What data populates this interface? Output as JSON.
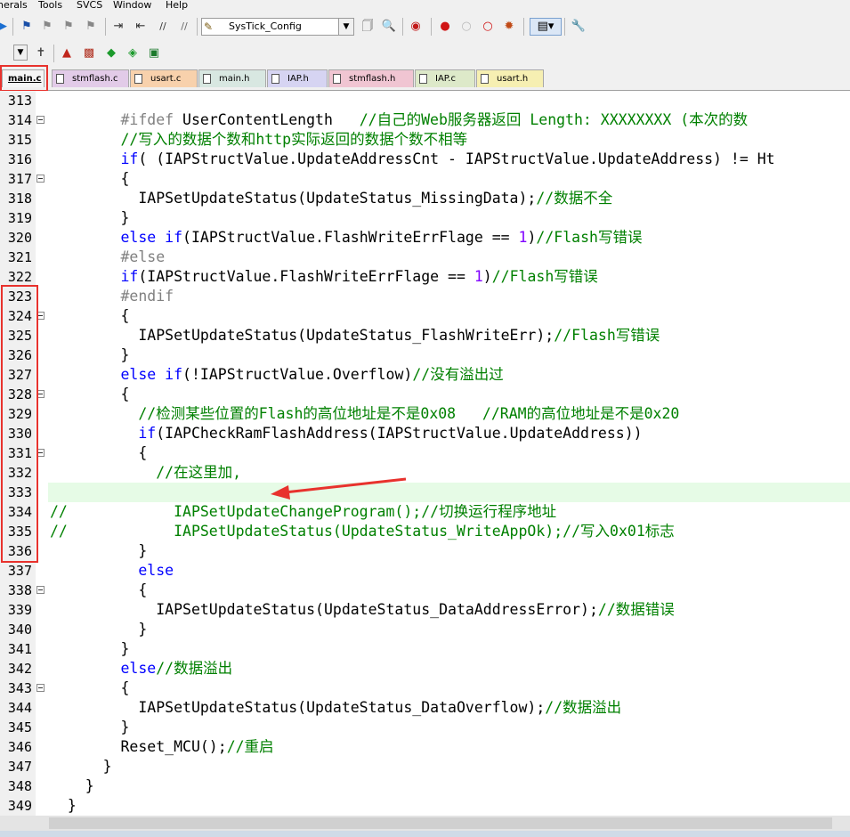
{
  "menu": [
    "herals",
    "Tools",
    "SVCS",
    "Window",
    "Help"
  ],
  "toolbar": {
    "target_combo": "SysTick_Config",
    "icons": [
      "run-icon",
      "bookmark-icon",
      "prev-bookmark-icon",
      "next-bookmark-icon",
      "clear-bookmarks-icon",
      "indent-icon",
      "unindent-icon",
      "comment-icon",
      "uncomment-icon",
      "find-in-files-icon",
      "find-icon",
      "debug-icon",
      "breakpoint-icon",
      "disable-breakpoint-icon",
      "kill-breakpoints-icon",
      "window-layout-icon",
      "configure-icon"
    ]
  },
  "tabs": [
    {
      "label": "main.c",
      "active": true,
      "color": "#f5f5f5"
    },
    {
      "label": "stmflash.c",
      "active": false,
      "color": "#e2cbe8"
    },
    {
      "label": "usart.c",
      "active": false,
      "color": "#f8d1ac"
    },
    {
      "label": "main.h",
      "active": false,
      "color": "#d8e7e1"
    },
    {
      "label": "IAP.h",
      "active": false,
      "color": "#d6d4f2"
    },
    {
      "label": "stmflash.h",
      "active": false,
      "color": "#f0c5d2"
    },
    {
      "label": "IAP.c",
      "active": false,
      "color": "#dde9c9"
    },
    {
      "label": "usart.h",
      "active": false,
      "color": "#f6efb2"
    }
  ],
  "lines": [
    {
      "num": "313",
      "fold": false,
      "code": ""
    },
    {
      "num": "314",
      "fold": true,
      "code": "        #ifdef UserContentLength   //自己的Web服务器返回 Length: XXXXXXXX (本次的数"
    },
    {
      "num": "315",
      "fold": false,
      "code": "        //写入的数据个数和http实际返回的数据个数不相等"
    },
    {
      "num": "316",
      "fold": false,
      "code": "        if( (IAPStructValue.UpdateAddressCnt - IAPStructValue.UpdateAddress) != Ht"
    },
    {
      "num": "317",
      "fold": true,
      "code": "        {"
    },
    {
      "num": "318",
      "fold": false,
      "code": "          IAPSetUpdateStatus(UpdateStatus_MissingData);//数据不全"
    },
    {
      "num": "319",
      "fold": false,
      "code": "        }"
    },
    {
      "num": "320",
      "fold": false,
      "code": "        else if(IAPStructValue.FlashWriteErrFlage == 1)//Flash写错误"
    },
    {
      "num": "321",
      "fold": false,
      "code": "        #else"
    },
    {
      "num": "322",
      "fold": false,
      "code": "        if(IAPStructValue.FlashWriteErrFlage == 1)//Flash写错误"
    },
    {
      "num": "323",
      "fold": false,
      "code": "        #endif"
    },
    {
      "num": "324",
      "fold": true,
      "code": "        {"
    },
    {
      "num": "325",
      "fold": false,
      "code": "          IAPSetUpdateStatus(UpdateStatus_FlashWriteErr);//Flash写错误"
    },
    {
      "num": "326",
      "fold": false,
      "code": "        }"
    },
    {
      "num": "327",
      "fold": false,
      "code": "        else if(!IAPStructValue.Overflow)//没有溢出过"
    },
    {
      "num": "328",
      "fold": true,
      "code": "        {"
    },
    {
      "num": "329",
      "fold": false,
      "code": "          //检测某些位置的Flash的高位地址是不是0x08   //RAM的高位地址是不是0x20"
    },
    {
      "num": "330",
      "fold": false,
      "code": "          if(IAPCheckRamFlashAddress(IAPStructValue.UpdateAddress))"
    },
    {
      "num": "331",
      "fold": true,
      "code": "          {"
    },
    {
      "num": "332",
      "fold": false,
      "code": "            //在这里加,"
    },
    {
      "num": "333",
      "fold": false,
      "code": "",
      "highlight": true
    },
    {
      "num": "334",
      "fold": false,
      "code": "//            IAPSetUpdateChangeProgram();//切换运行程序地址"
    },
    {
      "num": "335",
      "fold": false,
      "code": "//            IAPSetUpdateStatus(UpdateStatus_WriteAppOk);//写入0x01标志"
    },
    {
      "num": "336",
      "fold": false,
      "code": "          }"
    },
    {
      "num": "337",
      "fold": false,
      "code": "          else"
    },
    {
      "num": "338",
      "fold": true,
      "code": "          {"
    },
    {
      "num": "339",
      "fold": false,
      "code": "            IAPSetUpdateStatus(UpdateStatus_DataAddressError);//数据错误"
    },
    {
      "num": "340",
      "fold": false,
      "code": "          }"
    },
    {
      "num": "341",
      "fold": false,
      "code": "        }"
    },
    {
      "num": "342",
      "fold": false,
      "code": "        else//数据溢出"
    },
    {
      "num": "343",
      "fold": true,
      "code": "        {"
    },
    {
      "num": "344",
      "fold": false,
      "code": "          IAPSetUpdateStatus(UpdateStatus_DataOverflow);//数据溢出"
    },
    {
      "num": "345",
      "fold": false,
      "code": "        }"
    },
    {
      "num": "346",
      "fold": false,
      "code": "        Reset_MCU();//重启"
    },
    {
      "num": "347",
      "fold": false,
      "code": "      }"
    },
    {
      "num": "348",
      "fold": false,
      "code": "    }"
    },
    {
      "num": "349",
      "fold": false,
      "code": "  }"
    }
  ],
  "colors": {
    "keyword": "#0000ff",
    "preprocessor": "#808080",
    "comment": "#008000",
    "number": "#8000ff",
    "annotation_red": "#e8322d",
    "current_line": "#e6fbe6"
  }
}
